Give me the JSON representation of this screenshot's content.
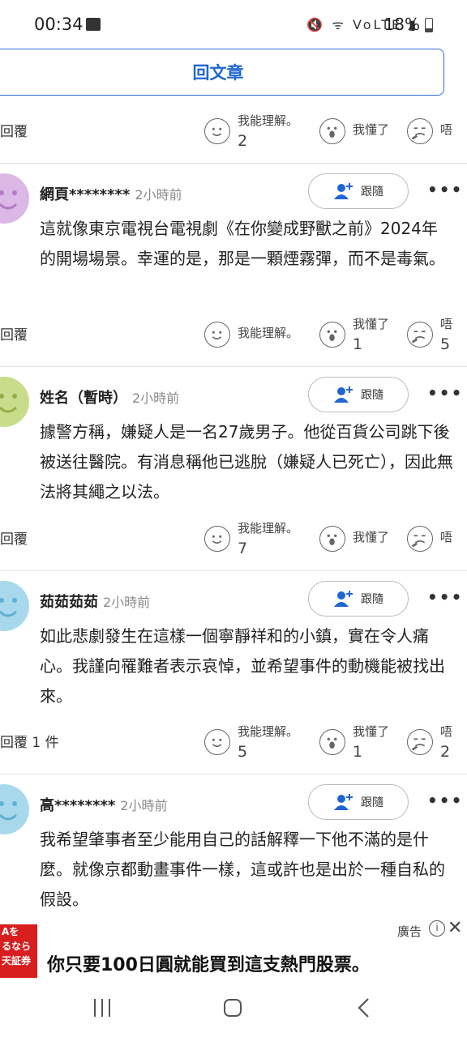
{
  "status": {
    "time": "00:34",
    "battery": "18%",
    "icons_text": "🔇 ᯤ VoLTE ▮"
  },
  "back_to_article": "回文章",
  "reactions_labels": {
    "understand": "我能理解。",
    "got_it": "我懂了",
    "sigh": "唔"
  },
  "first_reaction_row": {
    "reply": "回覆",
    "understand_count": "2",
    "got_it_count": "",
    "sigh_count": ""
  },
  "comments": [
    {
      "name": "網頁********",
      "time": "2小時前",
      "follow": "跟隨",
      "avatar_color": "#dcb8e6",
      "body": "這就像東京電視台電視劇《在你變成野獸之前》2024年的開場場景。幸運的是，那是一顆煙霧彈，而不是毒氣。",
      "reply": "回覆",
      "understand_count": "",
      "got_it_count": "1",
      "sigh_count": "5"
    },
    {
      "name": "姓名（暫時）",
      "time": "2小時前",
      "follow": "跟隨",
      "avatar_color": "#c8dc8a",
      "body": "據警方稱，嫌疑人是一名27歲男子。他從百貨公司跳下後被送往醫院。有消息稱他已逃脫（嫌疑人已死亡），因此無法將其繩之以法。",
      "reply": "回覆",
      "understand_count": "7",
      "got_it_count": "",
      "sigh_count": ""
    },
    {
      "name": "茹茹茹茹",
      "time": "2小時前",
      "follow": "跟隨",
      "avatar_color": "#a8d8ec",
      "body": "如此悲劇發生在這樣一個寧靜祥和的小鎮，實在令人痛心。我謹向罹難者表示哀悼，並希望事件的動機能被找出來。",
      "reply": "回覆 1 件",
      "understand_count": "5",
      "got_it_count": "1",
      "sigh_count": "2"
    },
    {
      "name": "高********",
      "time": "2小時前",
      "follow": "跟隨",
      "avatar_color": "#a8d8ec",
      "body": "我希望肇事者至少能用自己的話解釋一下他不滿的是什麼。就像京都動畫事件一樣，這或許也是出於一種自私的假設。"
    }
  ],
  "ad": {
    "tag": "廣告",
    "title": "你只要100日圓就能買到這支熱門股票。",
    "image_text": "Aを\nるなら\n天証券",
    "image_color": "#d81e1e"
  },
  "colors": {
    "accent": "#1f66d1"
  }
}
